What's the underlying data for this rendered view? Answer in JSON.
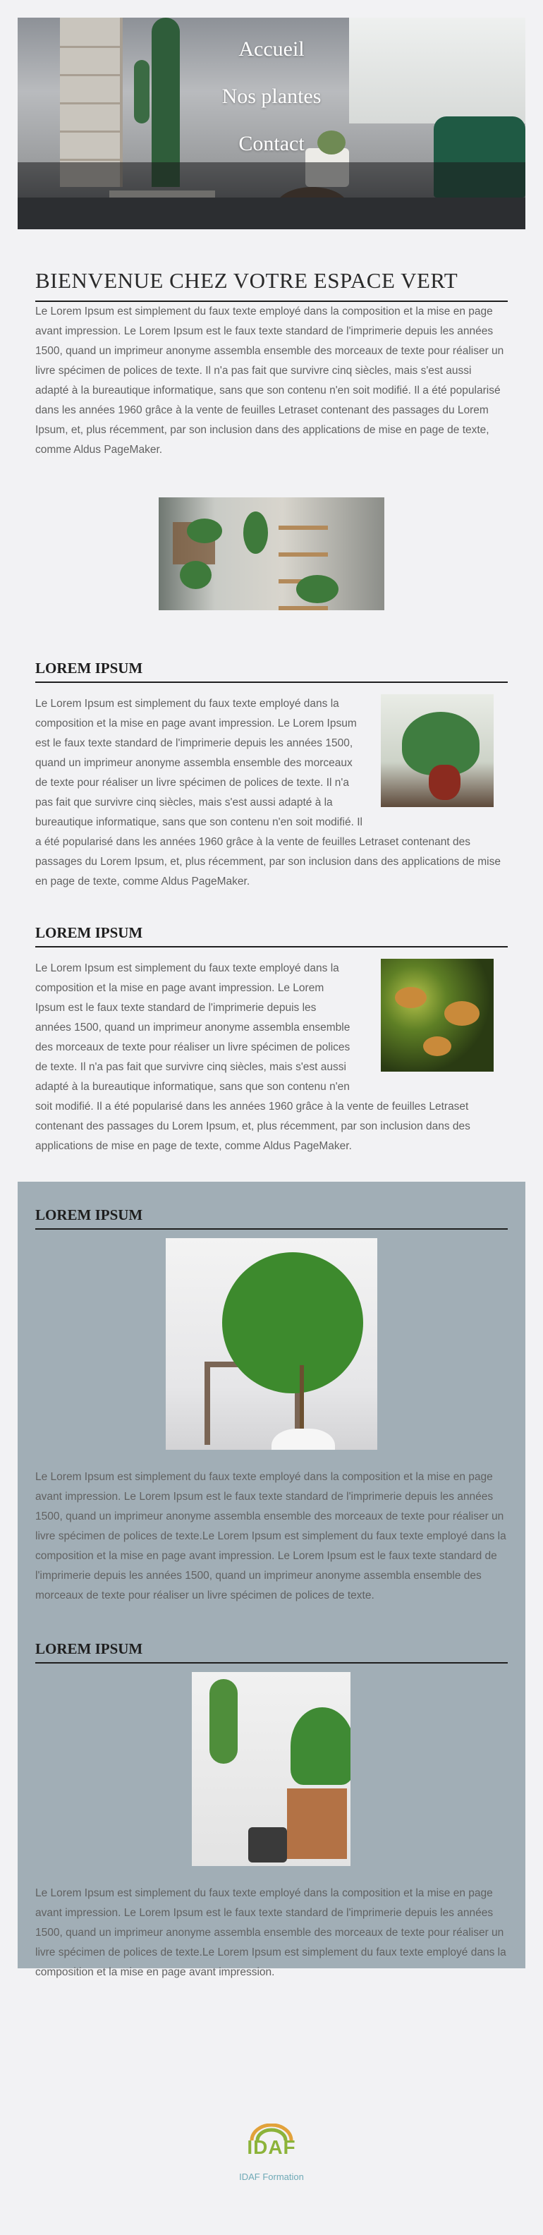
{
  "nav": {
    "items": [
      {
        "label": "Accueil"
      },
      {
        "label": "Nos plantes"
      },
      {
        "label": "Contact"
      }
    ]
  },
  "intro": {
    "title": "BIENVENUE CHEZ VOTRE ESPACE VERT",
    "text": "Le Lorem Ipsum est simplement du faux texte employé dans la composition et la mise en page avant impression. Le Lorem Ipsum est le faux texte standard de l'imprimerie depuis les années 1500, quand un imprimeur anonyme assembla ensemble des morceaux de texte pour réaliser un livre spécimen de polices de texte. Il n'a pas fait que survivre cinq siècles, mais s'est aussi adapté à la bureautique informatique, sans que son contenu n'en soit modifié. Il a été popularisé dans les années 1960 grâce à la vente de feuilles Letraset contenant des passages du Lorem Ipsum, et, plus récemment, par son inclusion dans des applications de mise en page de texte, comme Aldus PageMaker."
  },
  "sections": [
    {
      "heading": "LOREM IPSUM",
      "text_wrap": "Le Lorem Ipsum est simplement du faux texte employé dans la composition et la mise en page avant impression. Le Lorem Ipsum est le faux texte standard de l'imprimerie depuis les années 1500, quand un imprimeur anonyme assembla ensemble des morceaux de texte pour réaliser un livre spécimen de polices de texte. Il n'a pas fait que survivre cinq siècles, mais s'est",
      "text_full": "aussi adapté à la bureautique informatique, sans que son contenu n'en soit modifié. Il a été popularisé dans les années 1960 grâce à la vente de feuilles Letraset contenant des passages du Lorem Ipsum, et, plus récemment, par son inclusion dans des applications de mise en page de texte, comme Aldus PageMaker."
    },
    {
      "heading": "LOREM IPSUM",
      "text_wrap": "Le Lorem Ipsum est simplement du faux texte employé dans la composition et la mise en page avant impression. Le Lorem Ipsum est le faux texte standard de l'imprimerie depuis les années 1500, quand un imprimeur anonyme assembla ensemble des morceaux de texte pour réaliser un livre spécimen de polices de texte. Il n'a pas fait que survivre cinq siècles, mais s'est aussi adapté à la bureautique informatique,",
      "text_full": "sans que son contenu n'en soit modifié. Il a été popularisé dans les années 1960 grâce à la vente de feuilles Letraset contenant des passages du Lorem Ipsum, et, plus récemment, par son inclusion dans des applications de mise en page de texte, comme Aldus PageMaker."
    },
    {
      "heading": "LOREM IPSUM",
      "text": "Le Lorem Ipsum est simplement du faux texte employé dans la composition et la mise en page avant impression. Le Lorem Ipsum est le faux texte standard de l'imprimerie depuis les années 1500, quand un imprimeur anonyme assembla ensemble des morceaux de texte pour réaliser un livre spécimen de polices de texte.Le Lorem Ipsum est simplement du faux texte employé dans la composition et la mise en page avant impression. Le Lorem Ipsum est le faux texte standard de l'imprimerie depuis les années 1500, quand un imprimeur anonyme assembla ensemble des morceaux de texte pour réaliser un livre spécimen de polices de texte."
    },
    {
      "heading": "LOREM IPSUM",
      "text": "Le Lorem Ipsum est simplement du faux texte employé dans la composition et la mise en page avant impression. Le Lorem Ipsum est le faux texte standard de l'imprimerie depuis les années 1500, quand un imprimeur anonyme assembla ensemble des morceaux de texte pour réaliser un livre spécimen de polices de texte.Le Lorem Ipsum est simplement du faux texte employé dans la composition et la mise en page avant impression."
    }
  ],
  "footer": {
    "logo_text": "IDAF",
    "name": "IDAF Formation"
  },
  "colors": {
    "page_bg": "#f2f2f4",
    "gray_box": "#a1aeb6",
    "footer_link": "#6fa9b6",
    "logo_green": "#8cb33a",
    "logo_orange": "#e2a23a"
  }
}
